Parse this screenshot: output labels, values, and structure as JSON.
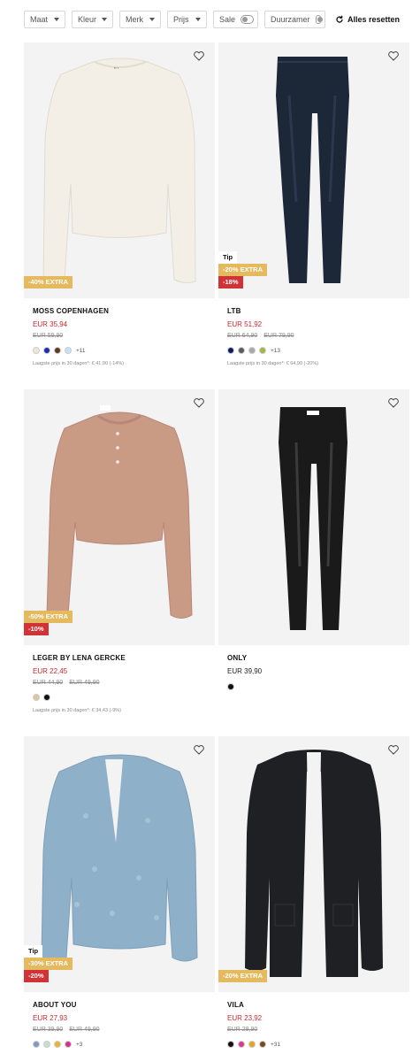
{
  "filters": {
    "maat": "Maat",
    "kleur": "Kleur",
    "merk": "Merk",
    "prijs": "Prijs",
    "sale": "Sale",
    "duurzamer": "Duurzamer",
    "reset": "Alles resetten"
  },
  "products": [
    {
      "brand": "MOSS COPENHAGEN",
      "price": "EUR 35,94",
      "old_prices": [
        "EUR 59,90"
      ],
      "badges": {
        "tip": "",
        "extra": "-40% EXTRA",
        "disc": ""
      },
      "swatches": [
        "#efe7d8",
        "#1b2fb1",
        "#5b3a20",
        "#c6e2f5"
      ],
      "more": "+11",
      "lowest": "Laagste prijs in 30 dagen*: € 41,90 (-14%)"
    },
    {
      "brand": "LTB",
      "price": "EUR 51,92",
      "old_prices": [
        "EUR 64,90",
        "EUR 79,90"
      ],
      "badges": {
        "tip": "Tip",
        "extra": "-20% EXTRA",
        "disc": "-18%"
      },
      "swatches": [
        "#0d1c5c",
        "#5b5b5b",
        "#a9a9a9",
        "#a8b34a"
      ],
      "more": "+13",
      "lowest": "Laagste prijs in 30 dagen*: € 64,90 (-20%)"
    },
    {
      "brand": "LEGER BY LENA GERCKE",
      "price": "EUR 22,45",
      "old_prices": [
        "EUR 44,90",
        "EUR 49,90"
      ],
      "badges": {
        "tip": "",
        "extra": "-50% EXTRA",
        "disc": "-10%"
      },
      "swatches": [
        "#d9c7a0",
        "#111111"
      ],
      "more": "",
      "lowest": "Laagste prijs in 30 dagen*: € 34,43 (-9%)"
    },
    {
      "brand": "ONLY",
      "price": "EUR 39,90",
      "old_prices": [],
      "badges": {
        "tip": "",
        "extra": "",
        "disc": ""
      },
      "swatches": [
        "#111111"
      ],
      "more": "",
      "lowest": ""
    },
    {
      "brand": "ABOUT YOU",
      "price": "EUR 27,93",
      "old_prices": [
        "EUR 39,90",
        "EUR 49,90"
      ],
      "badges": {
        "tip": "Tip",
        "extra": "-30% EXTRA",
        "disc": "-20%"
      },
      "swatches": [
        "#7e9ac2",
        "#bfe0d2",
        "#e3b62f",
        "#d4338b"
      ],
      "more": "+3",
      "lowest": ""
    },
    {
      "brand": "VILA",
      "price": "EUR 23,92",
      "old_prices": [
        "EUR 29,90"
      ],
      "badges": {
        "tip": "",
        "extra": "-20% EXTRA",
        "disc": ""
      },
      "swatches": [
        "#111111",
        "#e0348e",
        "#e6a21f",
        "#7a4a1e"
      ],
      "more": "+31",
      "lowest": ""
    }
  ]
}
